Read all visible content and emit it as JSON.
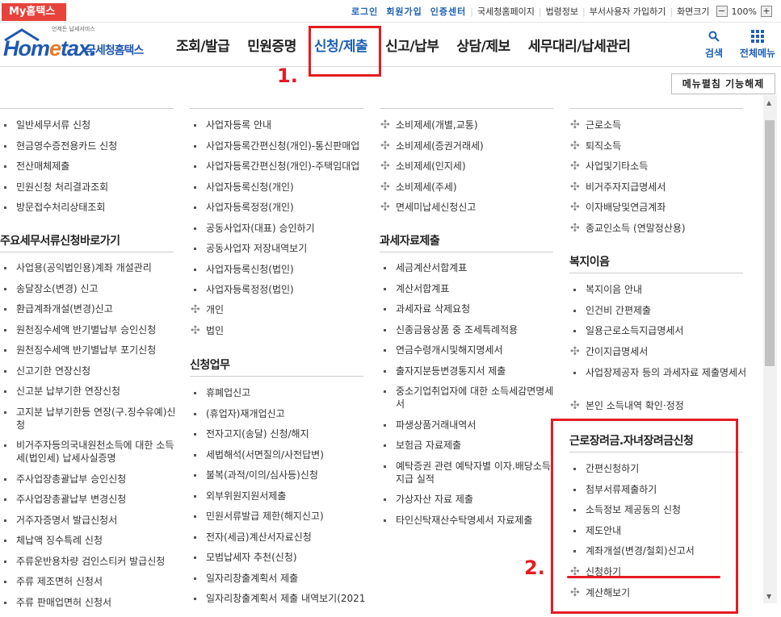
{
  "topbar": {
    "myhome": "My홈택스",
    "links": [
      {
        "label": "로그인",
        "blue": true
      },
      {
        "label": "회원가입",
        "blue": true
      },
      {
        "label": "인증센터",
        "blue": true
      },
      {
        "label": "국세청홈페이지",
        "blue": false
      },
      {
        "label": "법령정보",
        "blue": false
      },
      {
        "label": "부서사용자 가입하기",
        "blue": false
      },
      {
        "label": "화면크기",
        "blue": false
      }
    ],
    "zoom": "100%",
    "zoom_minus": "−",
    "zoom_plus": "+"
  },
  "logo": {
    "word_a": "Hom",
    "word_e": "e",
    "word_b": "tax.",
    "korean": "국세청홈택스",
    "small": "언제든 납세서비스"
  },
  "gnb": [
    "조회/발급",
    "민원증명",
    "신청/제출",
    "신고/납부",
    "상담/제보",
    "세무대리/납세관리"
  ],
  "gnb_active_index": 2,
  "header_right": {
    "search": "검색",
    "allmenu": "전체메뉴"
  },
  "menu_off_button": "메뉴펼침 기능해제",
  "annotations": {
    "num1": "1.",
    "num2": "2."
  },
  "colors": {
    "accent": "#1e5fb4",
    "red": "#e51c23",
    "myhome_bg": "#e8423c"
  },
  "col1": {
    "items_a": [
      "일반세무서류 신청",
      "현금영수증전용카드 신청",
      "전산매체제출",
      "민원신청 처리결과조회",
      "방문접수처리상태조회"
    ],
    "section_b": "주요세무서류신청바로가기",
    "items_b": [
      "사업용(공익법인용)계좌 개설관리",
      "송달장소(변경) 신고",
      "환급계좌개설(변경)신고",
      "원천징수세액 반기별납부 승인신청",
      "원천징수세액 반기별납부 포기신청",
      "신고기한 연장신청",
      "신고분 납부기한 연장신청",
      "고지분 납부기한등 연장(구.징수유예)신청",
      "비거주자등의국내원천소득에 대한 소득세(법인세) 납세사실증명",
      "주사업장총괄납부 승인신청",
      "주사업장총괄납부 변경신청",
      "거주자증명서 발급신청서",
      "체납액 징수특례 신청",
      "주류운반용차량 검인스티커 발급신청",
      "주류 제조면허 신청서",
      "주류 판매업면허 신청서"
    ]
  },
  "col2": {
    "items_a": [
      "사업자등록 안내",
      "사업자등록간편신청(개인)-통신판매업",
      "사업자등록간편신청(개인)-주택임대업",
      "사업자등록신청(개인)",
      "사업자등록정정(개인)",
      "공동사업자(대표) 승인하기",
      "공동사업자 저장내역보기",
      "사업자등록신청(법인)",
      "사업자등록정정(법인)"
    ],
    "items_a_plus": [
      "개인",
      "법인"
    ],
    "section_b": "신청업무",
    "items_b": [
      "휴폐업신고",
      "(휴업자)재개업신고",
      "전자고지(송달) 신청/해지",
      "세법해석(서면질의/사전답변)",
      "불복(과적/이의/심사등)신청",
      "외부위원지원서제출",
      "민원서류발급 제한(해지신고)",
      "전자(세금)계산서자료신청",
      "모범납세자 추천(신청)",
      "일자리창출계획서 제출",
      "일자리창출계획서 제출 내역보기(2021"
    ]
  },
  "col3": {
    "items_a_plus": [
      "소비제세(개별,교통)",
      "소비제세(증권거래세)",
      "소비제세(인지세)",
      "소비제세(주세)",
      "면세미납세신청신고"
    ],
    "section_b": "과세자료제출",
    "items_b": [
      "세금계산서합계표",
      "계산서합계표",
      "과세자료 삭제요청",
      "신종금융상품 중 조세특례적용",
      "연금수령개시및해지명세서",
      "출자지분등변경통지서 제출",
      "중소기업취업자에 대한 소득세감면명세서",
      "파생상품거래내역서",
      "보험금 자료제출",
      "예탁증권 관련 예탁자별 이자.배당소득 지급 실적",
      "가상자산 자료 제출",
      "타인신탁재산수탁명세서 자료제출"
    ]
  },
  "col4": {
    "items_a_plus": [
      "근로소득",
      "퇴직소득",
      "사업및기타소득",
      "비거주자지급명세서",
      "이자배당및연금계좌",
      "종교인소득 (연말정산용)"
    ],
    "section_b": "복지이음",
    "items_b": [
      "복지이음 안내",
      "인건비 간편제출",
      "일용근로소득지급명세서"
    ],
    "items_b_plus": [
      "간이지급명세서"
    ],
    "items_b2": [
      "사업장제공자 등의 과세자료 제출명세서"
    ],
    "items_b_plus2": [
      "본인 소득내역 확인·정정"
    ],
    "section_c": "근로장려금.자녀장려금신청",
    "items_c": [
      "간편신청하기",
      "첨부서류제출하기",
      "소득정보 제공동의 신청",
      "제도안내",
      "계좌개설(변경/철회)신고서"
    ],
    "items_c_plus": [
      "신청하기",
      "계산해보기"
    ]
  }
}
